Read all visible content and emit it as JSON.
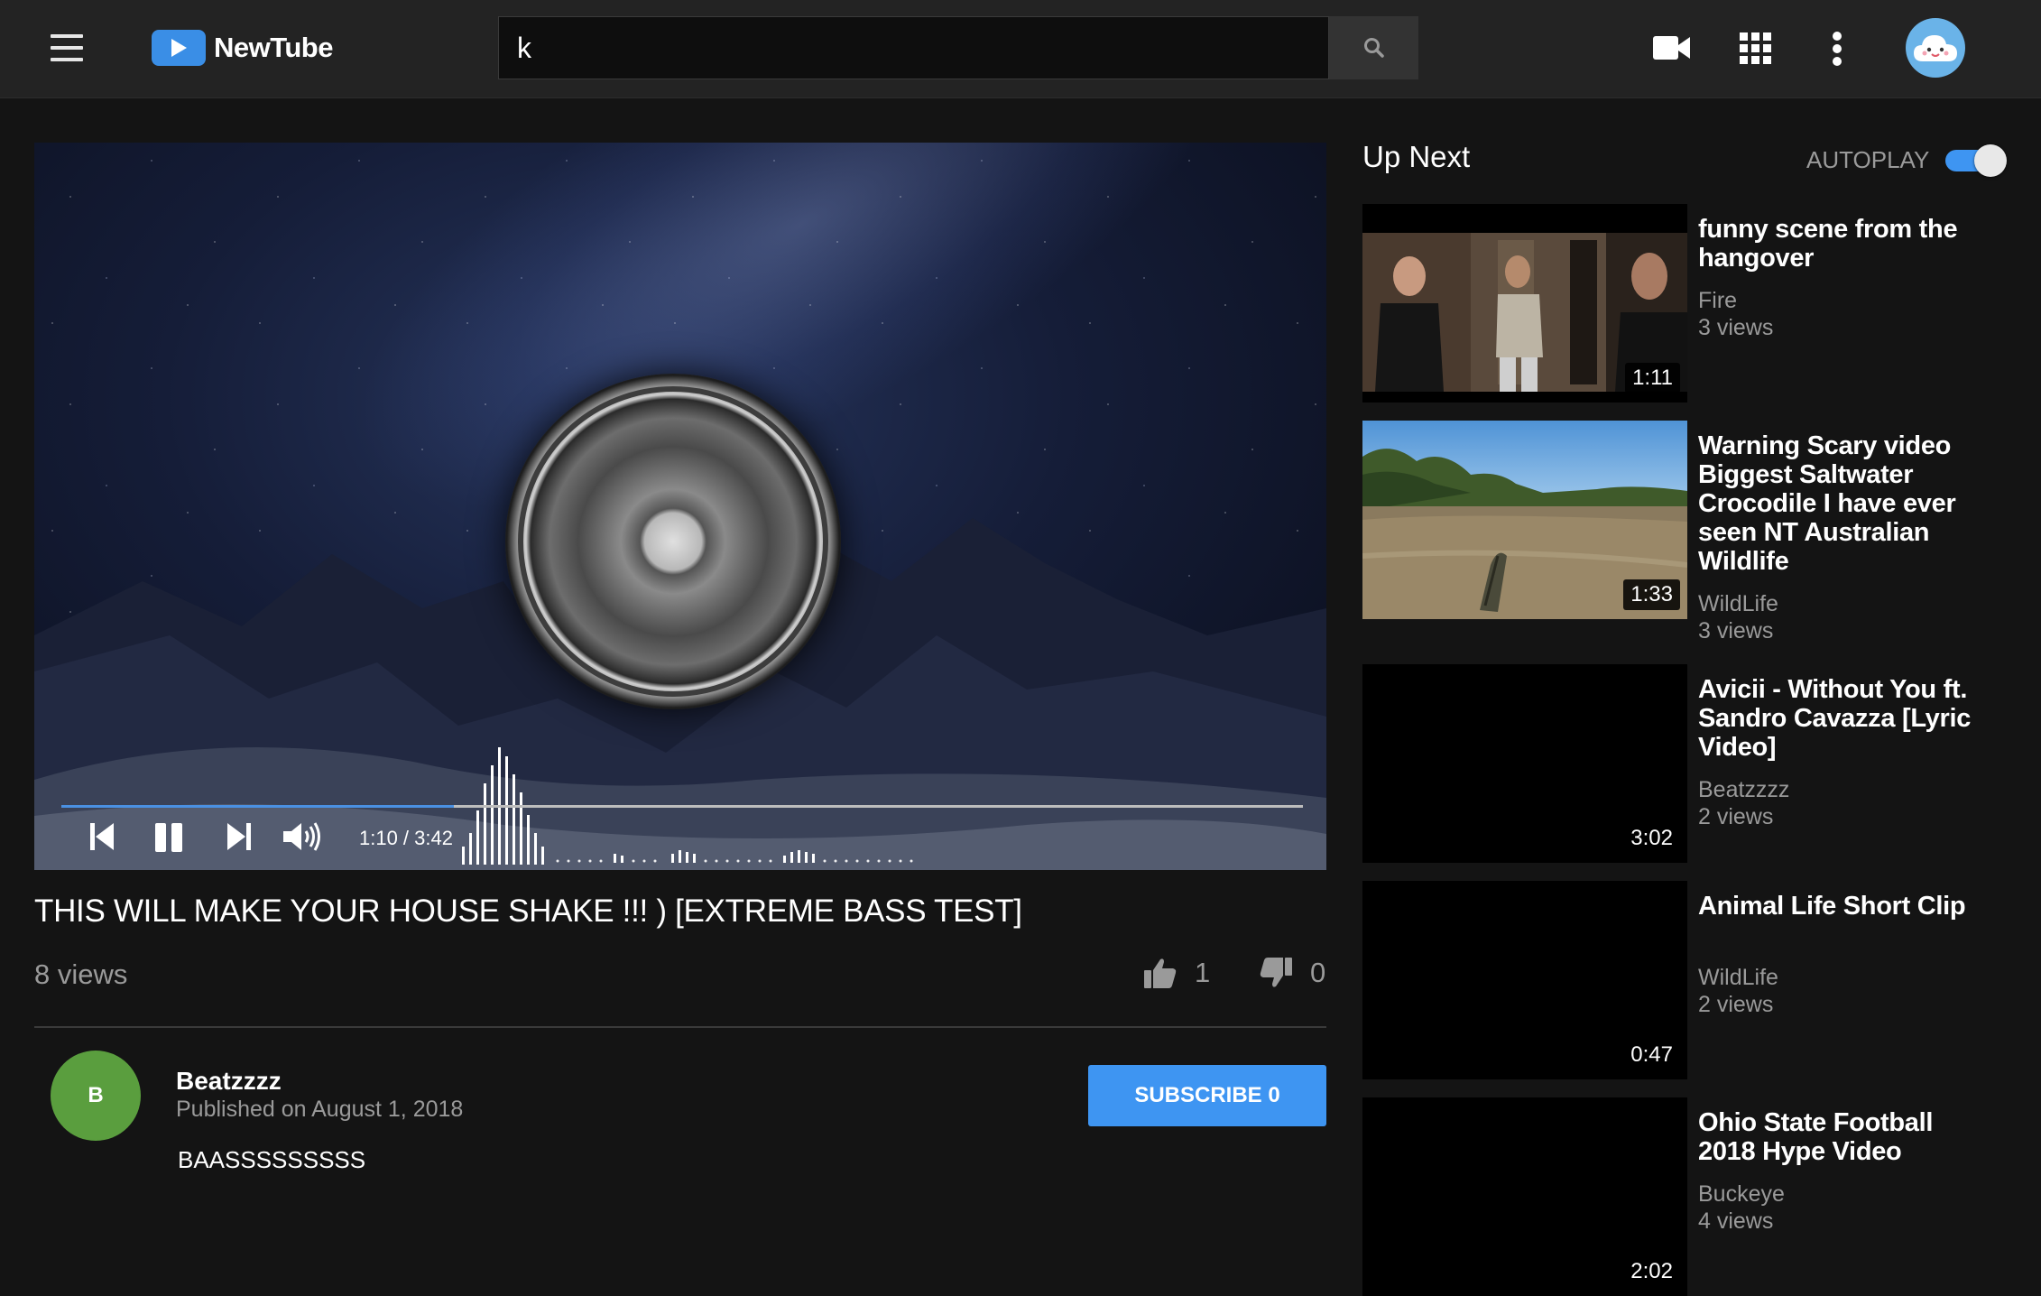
{
  "app": {
    "name": "NewTube"
  },
  "search": {
    "value": "k"
  },
  "player": {
    "current_time": "1:10",
    "duration": "3:42",
    "time_display": "1:10 / 3:42",
    "progress": 0.316
  },
  "video": {
    "title": "THIS WILL MAKE YOUR HOUSE SHAKE !!! ) [EXTREME BASS TEST]",
    "views": "8 views",
    "likes": "1",
    "dislikes": "0"
  },
  "channel": {
    "avatar_letter": "B",
    "name": "Beatzzzz",
    "published": "Published on August 1, 2018",
    "description": "BAASSSSSSSSS",
    "subscribe_label": "SUBSCRIBE 0"
  },
  "sidebar": {
    "up_next_label": "Up Next",
    "autoplay_label": "AUTOPLAY",
    "autoplay_on": true,
    "items": [
      {
        "title": "funny scene from the hangover",
        "channel": "Fire",
        "views": "3 views",
        "duration": "1:11"
      },
      {
        "title": "Warning Scary video Biggest Saltwater Crocodile I have ever seen NT Australian Wildlife",
        "channel": "WildLife",
        "views": "3 views",
        "duration": "1:33"
      },
      {
        "title": "Avicii - Without You ft. Sandro Cavazza [Lyric Video]",
        "channel": "Beatzzzz",
        "views": "2 views",
        "duration": "3:02"
      },
      {
        "title": "Animal Life Short Clip",
        "channel": "WildLife",
        "views": "2 views",
        "duration": "0:47"
      },
      {
        "title": "Ohio State Football 2018 Hype Video",
        "channel": "Buckeye",
        "views": "4 views",
        "duration": "2:02"
      }
    ]
  },
  "colors": {
    "accent": "#3e95f2",
    "background": "#141414",
    "topbar": "#232323",
    "channel_avatar": "#5a9e3e"
  },
  "icons": [
    "menu-icon",
    "play-logo-icon",
    "search-icon",
    "video-camera-icon",
    "apps-grid-icon",
    "more-vert-icon",
    "cloud-avatar-icon",
    "skip-previous-icon",
    "pause-icon",
    "skip-next-icon",
    "volume-icon",
    "thumbs-up-icon",
    "thumbs-down-icon"
  ]
}
